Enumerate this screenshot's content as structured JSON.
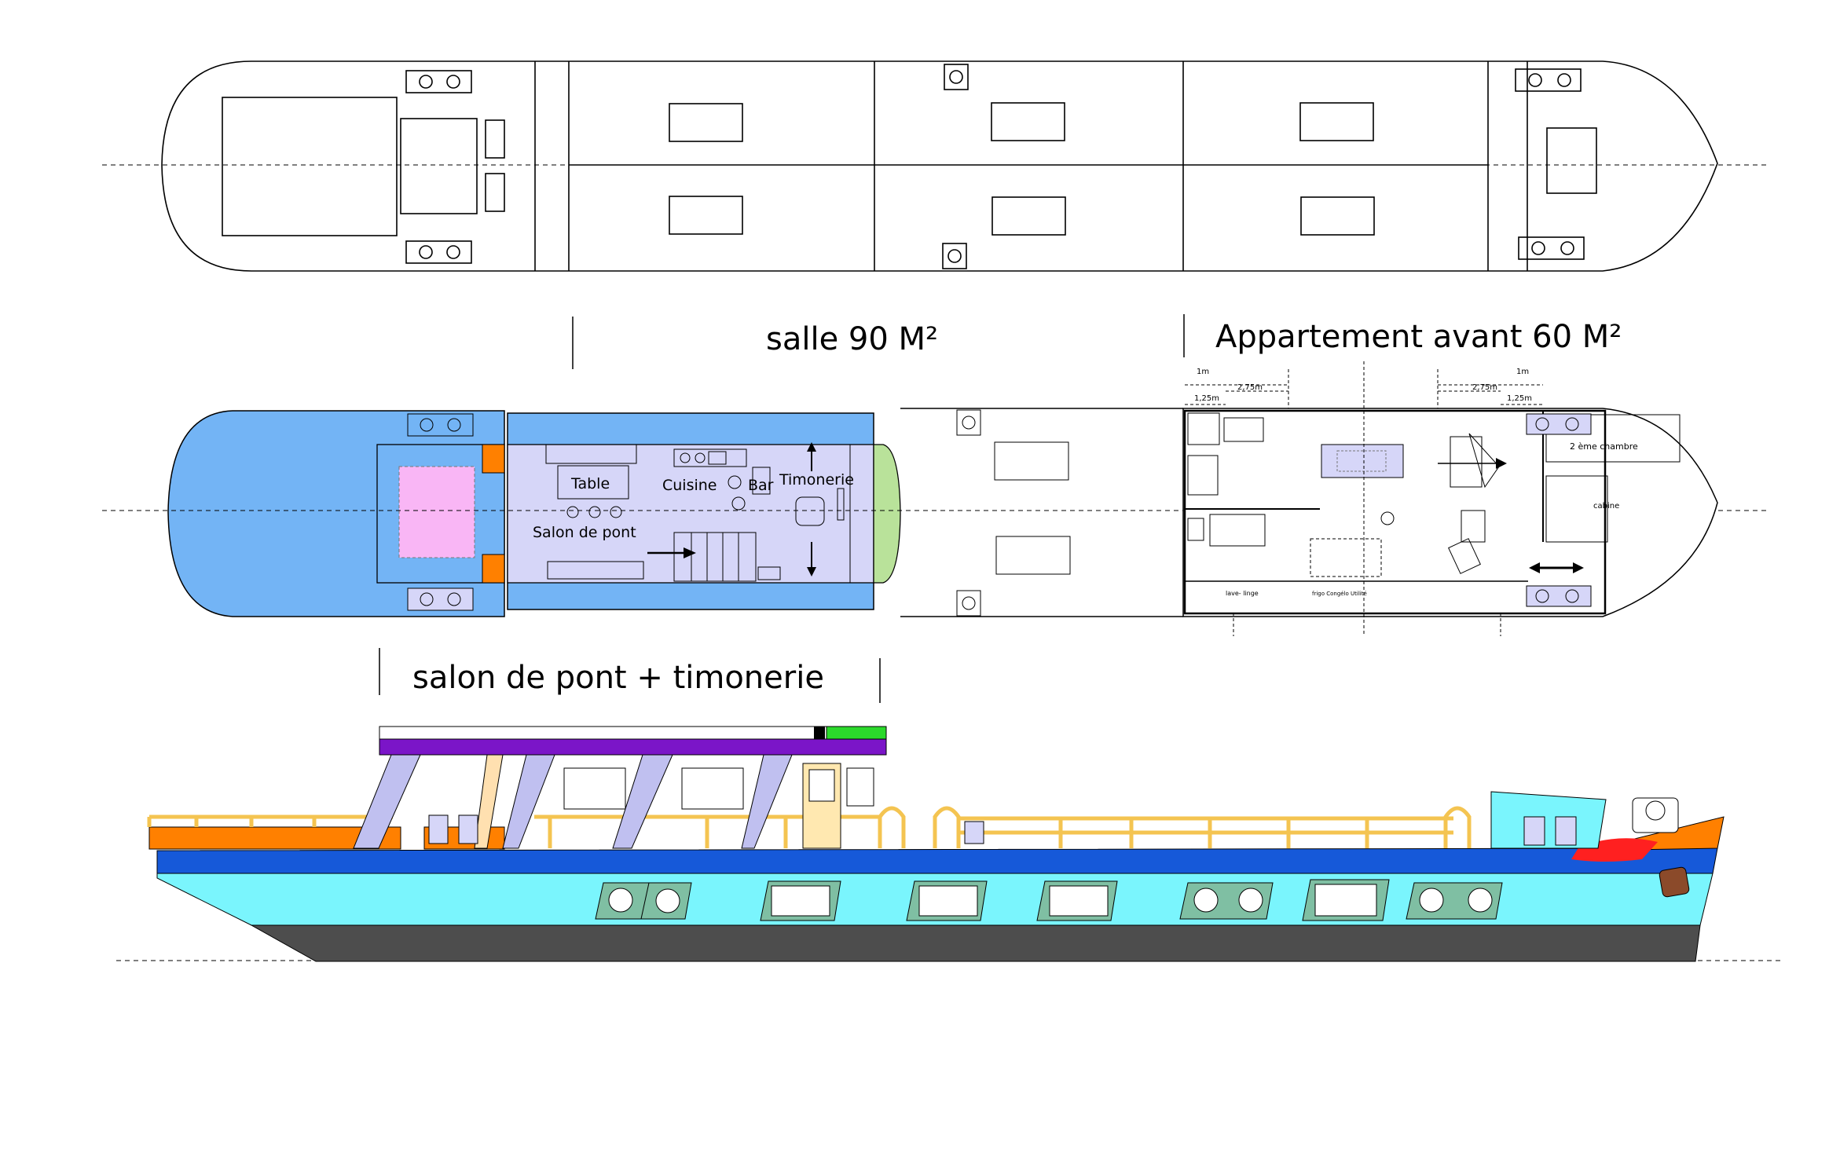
{
  "labels": {
    "salle": "salle 90 M²",
    "appartement": "Appartement avant  60 M²",
    "salon_timonerie": "salon de pont + timonerie",
    "table": "Table",
    "cuisine": "Cuisine",
    "bar": "Bar",
    "timonerie": "Timonerie",
    "salon_de_pont": "Salon de pont",
    "chambre2": "2 ème chambre",
    "cabine": "cabine",
    "lave_linge": "lave- linge",
    "frigo": "frigo Congélo Utilité"
  },
  "dimensions": {
    "d1m_left": "1m",
    "d275_left": "2,75m",
    "d125_left": "1,25m",
    "d275_right": "2,75m",
    "d1m_right": "1m",
    "d125_right": "1,25m"
  },
  "colors": {
    "deck_blue": "#73b4f5",
    "cabin_lavender": "#d6d6f8",
    "pink": "#f9b6f5",
    "orange": "#ff8000",
    "green_bow": "#b9e29a",
    "hull_cyan": "#7af5fd",
    "hull_blue": "#1659d9",
    "hull_grey": "#4d4d4d",
    "rail_yellow": "#f4c451",
    "roof_purple": "#7b15c8",
    "window_green": "#7fbfa3"
  }
}
